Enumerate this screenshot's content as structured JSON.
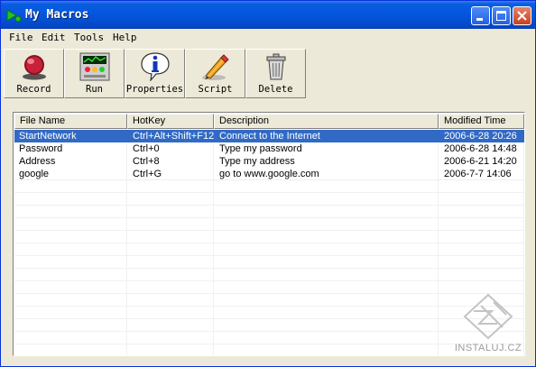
{
  "window": {
    "title": "My Macros"
  },
  "titlebar_buttons": {
    "minimize": "minimize-icon",
    "maximize": "maximize-icon",
    "close": "close-icon"
  },
  "menu": [
    "File",
    "Edit",
    "Tools",
    "Help"
  ],
  "toolbar": [
    {
      "label": "Record",
      "icon": "record-icon"
    },
    {
      "label": "Run",
      "icon": "run-icon"
    },
    {
      "label": "Properties",
      "icon": "properties-icon"
    },
    {
      "label": "Script",
      "icon": "script-icon"
    },
    {
      "label": "Delete",
      "icon": "delete-icon"
    }
  ],
  "table": {
    "columns": [
      "File Name",
      "HotKey",
      "Description",
      "Modified Time"
    ],
    "rows": [
      {
        "name": "StartNetwork",
        "hotkey": "Ctrl+Alt+Shift+F12",
        "description": "Connect to the Internet",
        "modified": "2006-6-28 20:26",
        "selected": true
      },
      {
        "name": "Password",
        "hotkey": "Ctrl+0",
        "description": "Type my password",
        "modified": "2006-6-28 14:48",
        "selected": false
      },
      {
        "name": "Address",
        "hotkey": "Ctrl+8",
        "description": "Type my address",
        "modified": "2006-6-21 14:20",
        "selected": false
      },
      {
        "name": "google",
        "hotkey": "Ctrl+G",
        "description": "go to www.google.com",
        "modified": "2006-7-7 14:06",
        "selected": false
      }
    ]
  },
  "watermark": {
    "text": "INSTALUJ.CZ"
  },
  "colors": {
    "titlebar": "#0455dc",
    "selection": "#316ac5",
    "close": "#c8411e"
  }
}
